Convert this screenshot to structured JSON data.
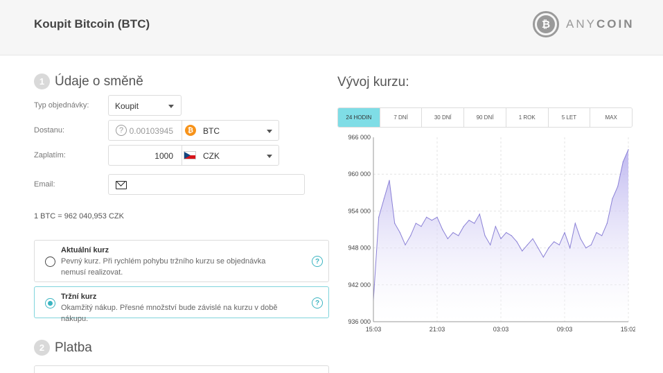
{
  "header": {
    "title": "Koupit Bitcoin (BTC)",
    "logo_text_a": "ANY",
    "logo_text_b": "COIN",
    "logo_mark": "₿"
  },
  "section1": {
    "number": "1",
    "title": "Údaje o směně"
  },
  "form": {
    "type_label": "Typ objednávky:",
    "type_value": "Koupit",
    "receive_label": "Dostanu:",
    "receive_amount": "0.00103945",
    "receive_currency": "BTC",
    "receive_icon": "bitcoin-icon",
    "pay_label": "Zaplatím:",
    "pay_amount": "1000",
    "pay_currency": "CZK",
    "pay_icon": "czech-flag-icon",
    "email_label": "Email:",
    "email_value": ""
  },
  "rate_text": "1 BTC = 962 040,953 CZK",
  "options": [
    {
      "title": "Aktuální kurz",
      "desc": "Pevný kurz. Při rychlém pohybu tržního kurzu se objednávka nemusí realizovat.",
      "selected": false
    },
    {
      "title": "Tržní kurz",
      "desc": "Okamžitý nákup. Přesné množství bude závislé na kurzu v době nákupu.",
      "selected": true
    }
  ],
  "section2": {
    "number": "2",
    "title": "Platba"
  },
  "chart_title": "Vývoj kurzu:",
  "tabs": [
    "24 HODIN",
    "7 DNÍ",
    "30 DNÍ",
    "90 DNÍ",
    "1 ROK",
    "5 LET",
    "MAX"
  ],
  "active_tab": 0,
  "colors": {
    "accent": "#7fdde6",
    "series_line": "#8a80d6",
    "series_fill": "#c9c3f0",
    "radio_on": "#3bb4c1"
  },
  "chart_data": {
    "type": "area",
    "title": "",
    "xlabel": "",
    "ylabel": "",
    "x_ticks": [
      "15:03",
      "21:03",
      "03:03",
      "09:03",
      "15:02"
    ],
    "y_ticks": [
      "936 000",
      "942 000",
      "948 000",
      "954 000",
      "960 000",
      "966 000"
    ],
    "ylim": [
      936000,
      966000
    ],
    "grid": true,
    "series": [
      {
        "x": [
          "15:03",
          "15:30",
          "16:00",
          "16:30",
          "17:00",
          "17:30",
          "18:00",
          "18:30",
          "19:00",
          "19:30",
          "20:00",
          "20:30",
          "21:03",
          "21:30",
          "22:00",
          "22:30",
          "23:00",
          "23:30",
          "00:00",
          "00:30",
          "01:00",
          "01:30",
          "02:00",
          "02:30",
          "03:03",
          "03:30",
          "04:00",
          "04:30",
          "05:00",
          "05:30",
          "06:00",
          "06:30",
          "07:00",
          "07:30",
          "08:00",
          "08:30",
          "09:03",
          "09:30",
          "10:00",
          "10:30",
          "11:00",
          "11:30",
          "12:00",
          "12:30",
          "13:00",
          "13:30",
          "14:00",
          "14:30",
          "15:02"
        ],
        "values": [
          939500,
          953000,
          956000,
          959000,
          952000,
          950500,
          948500,
          950000,
          952000,
          951500,
          953000,
          952500,
          953000,
          951000,
          949500,
          950500,
          950000,
          951500,
          952500,
          952000,
          953500,
          950000,
          948500,
          951500,
          949500,
          950500,
          950000,
          949000,
          947500,
          948500,
          949500,
          948000,
          946500,
          948000,
          949000,
          948500,
          950500,
          948000,
          952000,
          949500,
          948000,
          948500,
          950500,
          950000,
          952000,
          956000,
          958000,
          962000,
          964000
        ]
      }
    ]
  }
}
